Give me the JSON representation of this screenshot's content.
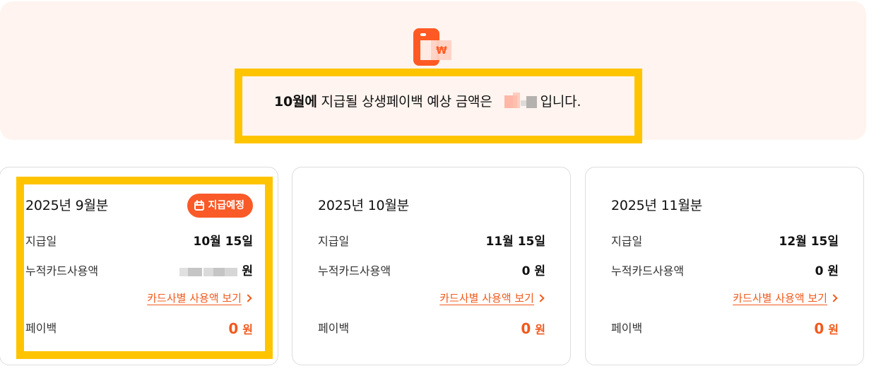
{
  "banner": {
    "icon_name": "wallet-payback-icon",
    "month": "10월에",
    "text_before": " 지급될 상생페이백 예상 금액은",
    "text_after": "입니다.",
    "masked_amount_name": "masked-amount"
  },
  "cards": [
    {
      "title": "2025년 9월분",
      "badge": {
        "label": "지급예정",
        "icon_name": "calendar-icon"
      },
      "payment_date_label": "지급일",
      "payment_date_value": "10월 15일",
      "usage_label": "누적카드사용액",
      "usage_value_unit": "원",
      "detail_link_label": "카드사별 사용액 보기",
      "payback_label": "페이백",
      "payback_amount": "0",
      "payback_unit": "원"
    },
    {
      "title": "2025년 10월분",
      "payment_date_label": "지급일",
      "payment_date_value": "11월 15일",
      "usage_label": "누적카드사용액",
      "usage_value": "0 원",
      "detail_link_label": "카드사별 사용액 보기",
      "payback_label": "페이백",
      "payback_amount": "0",
      "payback_unit": "원"
    },
    {
      "title": "2025년 11월분",
      "payment_date_label": "지급일",
      "payment_date_value": "12월 15일",
      "usage_label": "누적카드사용액",
      "usage_value": "0 원",
      "detail_link_label": "카드사별 사용액 보기",
      "payback_label": "페이백",
      "payback_amount": "0",
      "payback_unit": "원"
    }
  ],
  "colors": {
    "accent": "#f95a28",
    "banner_bg": "#fff4ef",
    "highlight": "#ffc400"
  }
}
